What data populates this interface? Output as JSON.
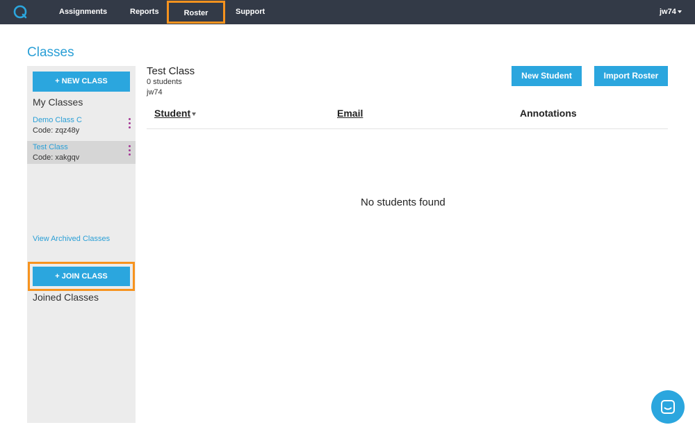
{
  "nav": {
    "items": [
      "Assignments",
      "Reports",
      "Roster",
      "Support"
    ],
    "user": "jw74",
    "logo_icon": "app-logo-icon"
  },
  "page": {
    "title": "Classes"
  },
  "sidebar": {
    "new_class_label": "+ NEW CLASS",
    "my_classes_heading": "My Classes",
    "classes": [
      {
        "name": "Demo Class C",
        "code": "Code: zqz48y",
        "active": false
      },
      {
        "name": "Test Class",
        "code": "Code: xakgqv",
        "active": true
      }
    ],
    "view_archived_label": "View Archived Classes",
    "join_class_label": "+ JOIN CLASS",
    "joined_classes_heading": "Joined Classes"
  },
  "main": {
    "class_title": "Test Class",
    "student_count": "0 students",
    "owner": "jw74",
    "new_student_label": "New Student",
    "import_roster_label": "Import Roster",
    "columns": [
      "Student",
      "Email",
      "Annotations"
    ],
    "empty_message": "No students found"
  },
  "colors": {
    "nav_bg": "#333a47",
    "accent": "#2ba6de",
    "highlight": "#f7931e",
    "kebab": "#a43a96"
  },
  "chat": {
    "icon": "chat-icon"
  }
}
